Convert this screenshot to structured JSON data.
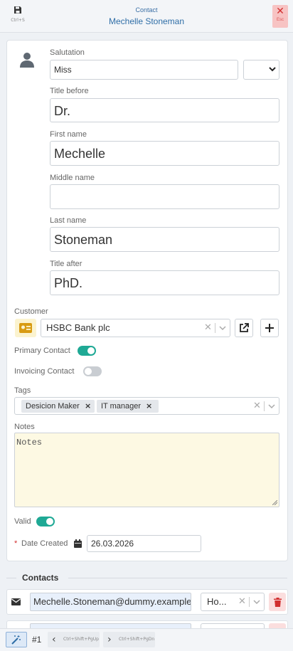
{
  "header": {
    "save_shortcut": "Ctrl+S",
    "title_small": "Contact",
    "title_main": "Mechelle Stoneman",
    "close_shortcut": "Esc"
  },
  "form": {
    "salutation": {
      "label": "Salutation",
      "value": "Miss"
    },
    "title_before": {
      "label": "Title before",
      "value": "Dr."
    },
    "first_name": {
      "label": "First name",
      "value": "Mechelle"
    },
    "middle_name": {
      "label": "Middle name",
      "value": ""
    },
    "last_name": {
      "label": "Last name",
      "value": "Stoneman"
    },
    "title_after": {
      "label": "Title after",
      "value": "PhD."
    },
    "customer": {
      "label": "Customer",
      "value": "HSBC Bank plc"
    },
    "primary_contact": {
      "label": "Primary Contact",
      "on": true
    },
    "invoicing_contact": {
      "label": "Invoicing Contact",
      "on": false
    },
    "tags": {
      "label": "Tags",
      "items": [
        "Desicion Maker",
        "IT manager"
      ]
    },
    "notes": {
      "label": "Notes",
      "placeholder": "Notes",
      "value": ""
    },
    "valid": {
      "label": "Valid",
      "on": true
    },
    "date_created": {
      "label": "Date Created",
      "required_mark": "*",
      "value": "26.03.2026"
    }
  },
  "contacts": {
    "title": "Contacts",
    "rows": [
      {
        "value": "Mechelle.Stoneman@dummy.example",
        "type": "Ho..."
      }
    ]
  },
  "footer": {
    "record_number": "#1",
    "prev_shortcut": "Ctrl+Shift+PgUp",
    "next_shortcut": "Ctrl+Shift+PgDn"
  },
  "colors": {
    "accent": "#2f6ea7",
    "toggle_on": "#1fa995",
    "danger": "#d12f2f",
    "notes_bg": "#fdf9e3"
  }
}
